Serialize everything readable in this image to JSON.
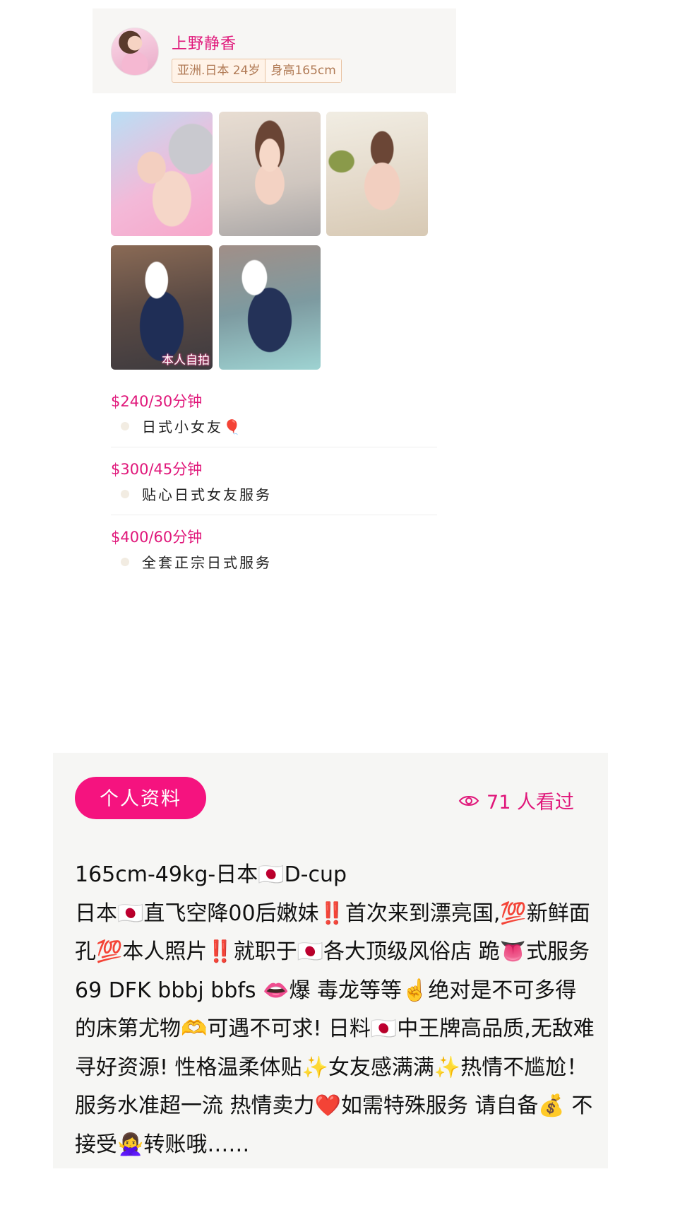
{
  "profile": {
    "name": "上野静香",
    "tags": [
      "亚洲.日本 24岁",
      "身高165cm"
    ]
  },
  "photos": [
    {
      "caption": ""
    },
    {
      "caption": ""
    },
    {
      "caption": ""
    },
    {
      "caption": "本人自拍"
    },
    {
      "caption": ""
    }
  ],
  "prices": [
    {
      "price": "$240/30分钟",
      "service": "日式小女友🎈"
    },
    {
      "price": "$300/45分钟",
      "service": "贴心日式女友服务"
    },
    {
      "price": "$400/60分钟",
      "service": "全套正宗日式服务"
    }
  ],
  "about": {
    "tab_label": "个人资料",
    "views_label": "71 人看过",
    "icon": "eye-icon",
    "text": "165cm-49kg-日本🇯🇵D-cup\n日本🇯🇵直飞空降00后嫩妹‼️首次来到漂亮国,💯新鲜面孔💯本人照片‼️就职于🇯🇵各大顶级风俗店 跪👅式服务 69 DFK bbbj bbfs 👄爆 毒龙等等☝️绝对是不可多得的床第尤物🫶可遇不可求! 日料🇯🇵中王牌高品质,无敌难寻好资源! 性格温柔体贴✨女友感满满✨热情不尴尬！ 服务水准超一流 热情卖力❤️如需特殊服务 请自备💰 不接受🙅‍♀️转账哦……"
  },
  "colors": {
    "accent": "#e0177a",
    "button": "#f5137f",
    "tag_border": "#e8c3a3"
  }
}
